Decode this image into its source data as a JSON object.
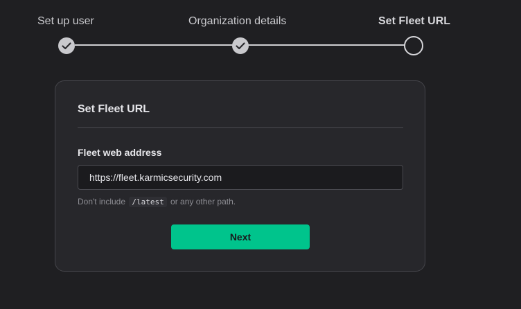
{
  "stepper": {
    "steps": [
      {
        "label": "Set up user",
        "status": "complete"
      },
      {
        "label": "Organization details",
        "status": "complete"
      },
      {
        "label": "Set Fleet URL",
        "status": "current"
      }
    ],
    "complete_icon": "check-icon"
  },
  "card": {
    "title": "Set Fleet URL",
    "field_label": "Fleet web address",
    "url_value": "https://fleet.karmicsecurity.com",
    "hint_prefix": "Don't include",
    "hint_code": "/latest",
    "hint_suffix": "or any other path.",
    "next_label": "Next"
  },
  "colors": {
    "background": "#1f1f22",
    "card": "#27272b",
    "accent": "#00c48c"
  }
}
